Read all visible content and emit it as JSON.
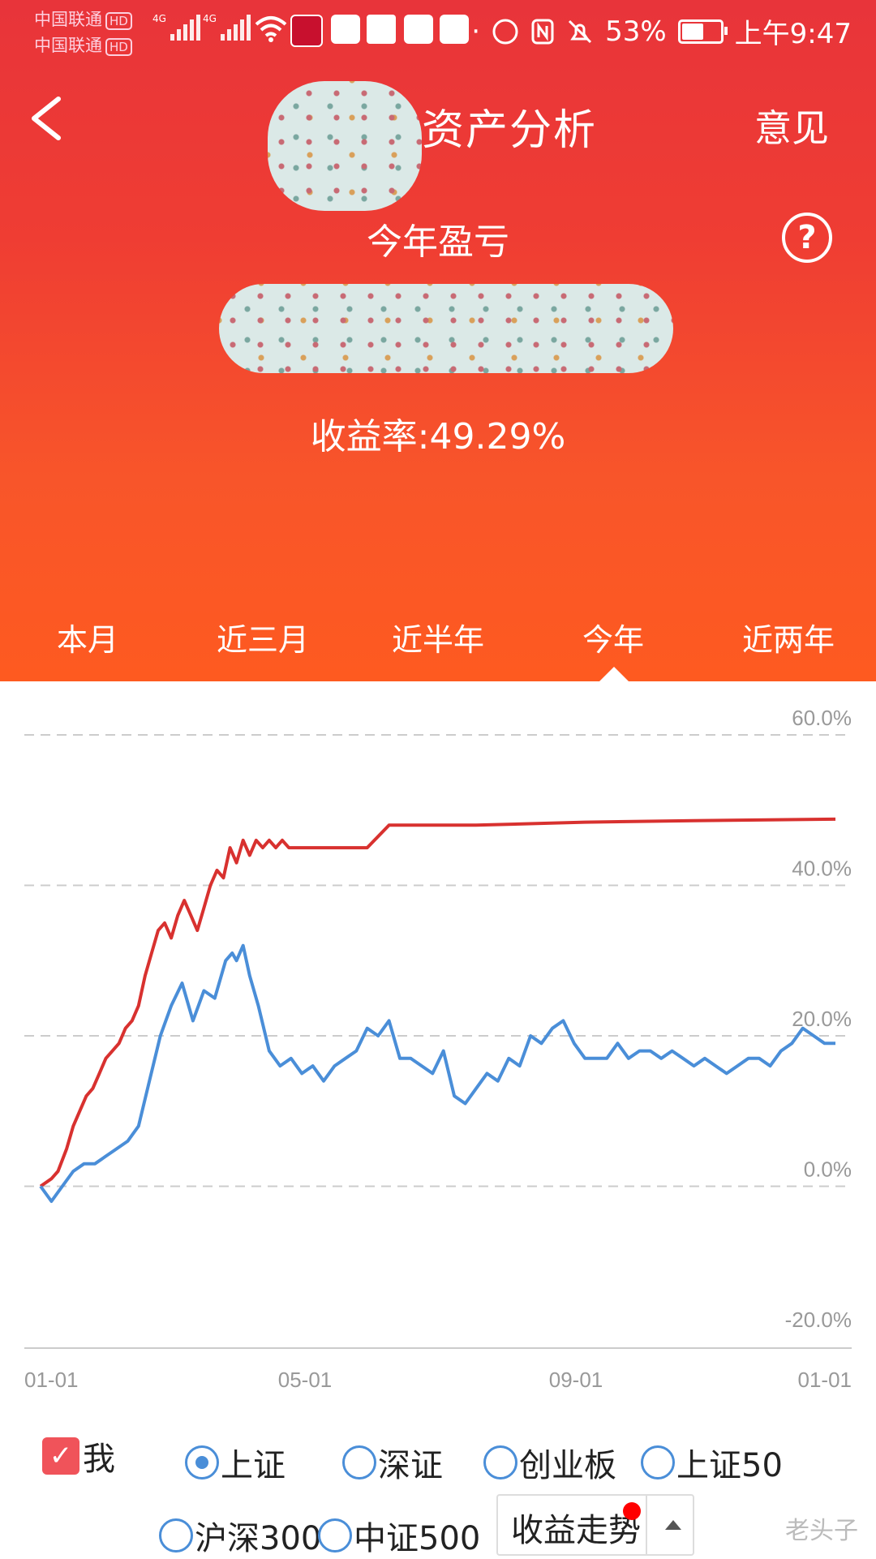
{
  "status_bar": {
    "carrier1": "中国联通",
    "carrier2": "中国联通",
    "hd": "HD",
    "net1": "4G",
    "net2": "4G",
    "battery_pct": "53%",
    "time": "上午9:47",
    "more": "···"
  },
  "nav": {
    "title": "资产分析",
    "feedback": "意见"
  },
  "summary": {
    "label": "今年盈亏",
    "help": "?",
    "rate": "收益率:49.29%"
  },
  "tabs": [
    {
      "label": "本月"
    },
    {
      "label": "近三月"
    },
    {
      "label": "近半年"
    },
    {
      "label": "今年",
      "active": true
    },
    {
      "label": "近两年"
    }
  ],
  "chart_data": {
    "type": "line",
    "y_ticks": [
      "60.0%",
      "40.0%",
      "20.0%",
      "0.0%",
      "-20.0%"
    ],
    "x_ticks": [
      "01-01",
      "05-01",
      "09-01",
      "01-01"
    ],
    "ylim": [
      -20,
      60
    ],
    "series": [
      {
        "color": "#d8312f",
        "x": [
          0,
          5,
          8,
          12,
          15,
          18,
          21,
          24,
          27,
          30,
          33,
          36,
          39,
          42,
          45,
          48,
          51,
          54,
          57,
          60,
          63,
          66,
          69,
          72,
          75,
          78,
          81,
          84,
          87,
          90,
          93,
          96,
          99,
          102,
          105,
          108,
          111,
          114,
          117,
          120,
          140,
          150,
          160,
          180,
          200,
          250,
          300,
          365
        ],
        "y": [
          0,
          1,
          2,
          5,
          8,
          10,
          12,
          13,
          15,
          17,
          18,
          19,
          21,
          22,
          24,
          28,
          31,
          34,
          35,
          33,
          36,
          38,
          36,
          34,
          37,
          40,
          42,
          41,
          45,
          43,
          46,
          44,
          46,
          45,
          46,
          45,
          46,
          45,
          45,
          45,
          45,
          45,
          48,
          48,
          48,
          48.4,
          48.6,
          48.8
        ]
      },
      {
        "color": "#4a8ed8",
        "x": [
          0,
          5,
          10,
          15,
          20,
          25,
          30,
          35,
          40,
          45,
          50,
          55,
          60,
          65,
          70,
          75,
          80,
          85,
          88,
          90,
          93,
          96,
          100,
          105,
          110,
          115,
          120,
          125,
          130,
          135,
          140,
          145,
          150,
          155,
          160,
          165,
          170,
          175,
          180,
          185,
          190,
          195,
          200,
          205,
          210,
          215,
          220,
          225,
          230,
          235,
          240,
          245,
          250,
          255,
          260,
          265,
          270,
          275,
          280,
          285,
          290,
          295,
          300,
          305,
          310,
          315,
          320,
          325,
          330,
          335,
          340,
          345,
          350,
          355,
          360,
          365
        ],
        "y": [
          0,
          -2,
          0,
          2,
          3,
          3,
          4,
          5,
          6,
          8,
          14,
          20,
          24,
          27,
          22,
          26,
          25,
          30,
          31,
          30,
          32,
          28,
          24,
          18,
          16,
          17,
          15,
          16,
          14,
          16,
          17,
          18,
          21,
          20,
          22,
          17,
          17,
          16,
          15,
          18,
          12,
          11,
          13,
          15,
          14,
          17,
          16,
          20,
          19,
          21,
          22,
          19,
          17,
          17,
          17,
          19,
          17,
          18,
          18,
          17,
          18,
          17,
          16,
          17,
          16,
          15,
          16,
          17,
          17,
          16,
          18,
          19,
          21,
          20,
          19,
          19
        ]
      }
    ]
  },
  "legend": {
    "me": "我",
    "sh": "上证",
    "sz": "深证",
    "cyb": "创业板",
    "sz50": "上证50",
    "hs300": "沪深300",
    "zz500": "中证500"
  },
  "select": {
    "label": "收益走势"
  },
  "watermark": "老头子"
}
